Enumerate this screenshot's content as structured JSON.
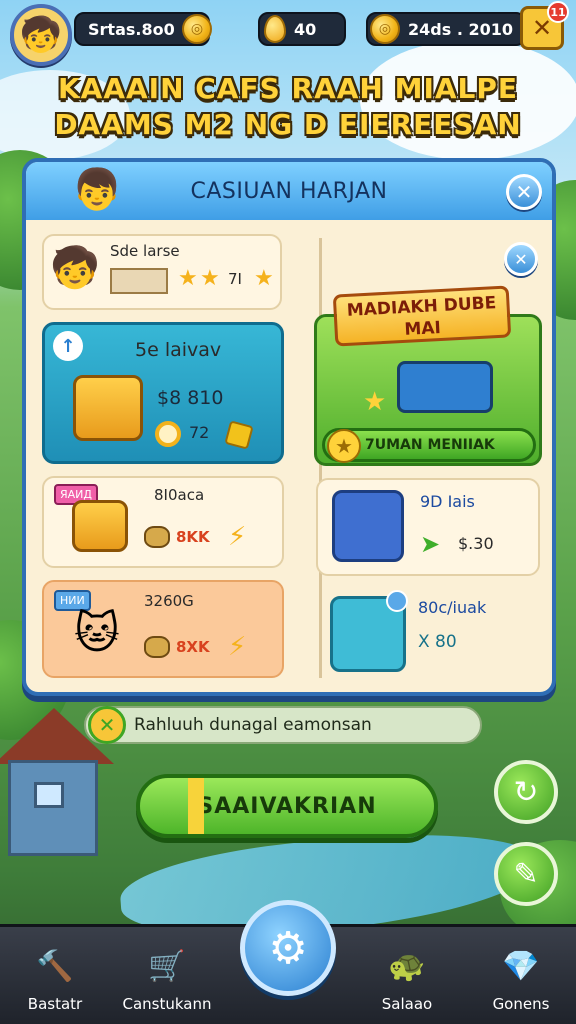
{
  "top_bar": {
    "resource_1": "Srtas.8o0",
    "resource_2": "40",
    "resource_3": "24ds . 2010",
    "notification_count": "11",
    "menu_icon": "close-x-icon"
  },
  "headline": {
    "line1": "KAAAIN CAFS RAAH MIALPE",
    "line2": "DAAMS M2 NG D EIEREESAN"
  },
  "panel": {
    "title": "CASIUAN HARJAN",
    "close_symbol": "✕",
    "inner_close_symbol": "✕",
    "left_items": [
      {
        "title": "Sde larse",
        "value": "7I"
      },
      {
        "title": "5e laivav",
        "price": "$8 810",
        "count": "72"
      },
      {
        "title": "8I0aca",
        "badge": "ЯАИД",
        "value": "8KK"
      },
      {
        "title": "3260G",
        "badge": "НИИ",
        "value": "8XK"
      }
    ],
    "featured": {
      "banner": "MADIAKH DUBE MAI",
      "button_label": "7UMAN MENIIAK"
    },
    "right_items": [
      {
        "title": "9D Iais",
        "price": "$.30"
      },
      {
        "title": "80c/iuak",
        "price": "X 80"
      }
    ]
  },
  "info_bar": {
    "text": "Rahluuh dunagal eamonsan"
  },
  "main_button": {
    "label": "SAAIVAKRIAN"
  },
  "side_buttons": {
    "top_icon": "refresh-icon",
    "bottom_icon": "wrench-icon"
  },
  "bottom_nav": {
    "items": [
      {
        "label": "Bastatr",
        "icon": "hammer-icon"
      },
      {
        "label": "Canstukann",
        "icon": "cart-icon"
      },
      {
        "label": "Salaao",
        "icon": "turtle-icon"
      },
      {
        "label": "Gonens",
        "icon": "gem-icon"
      }
    ],
    "center_icon": "settings-gear-icon"
  },
  "colors": {
    "panel_border": "#2f6eb5",
    "panel_bg": "#fbf0d6",
    "accent_green": "#5bc236",
    "accent_gold": "#f7c638"
  }
}
